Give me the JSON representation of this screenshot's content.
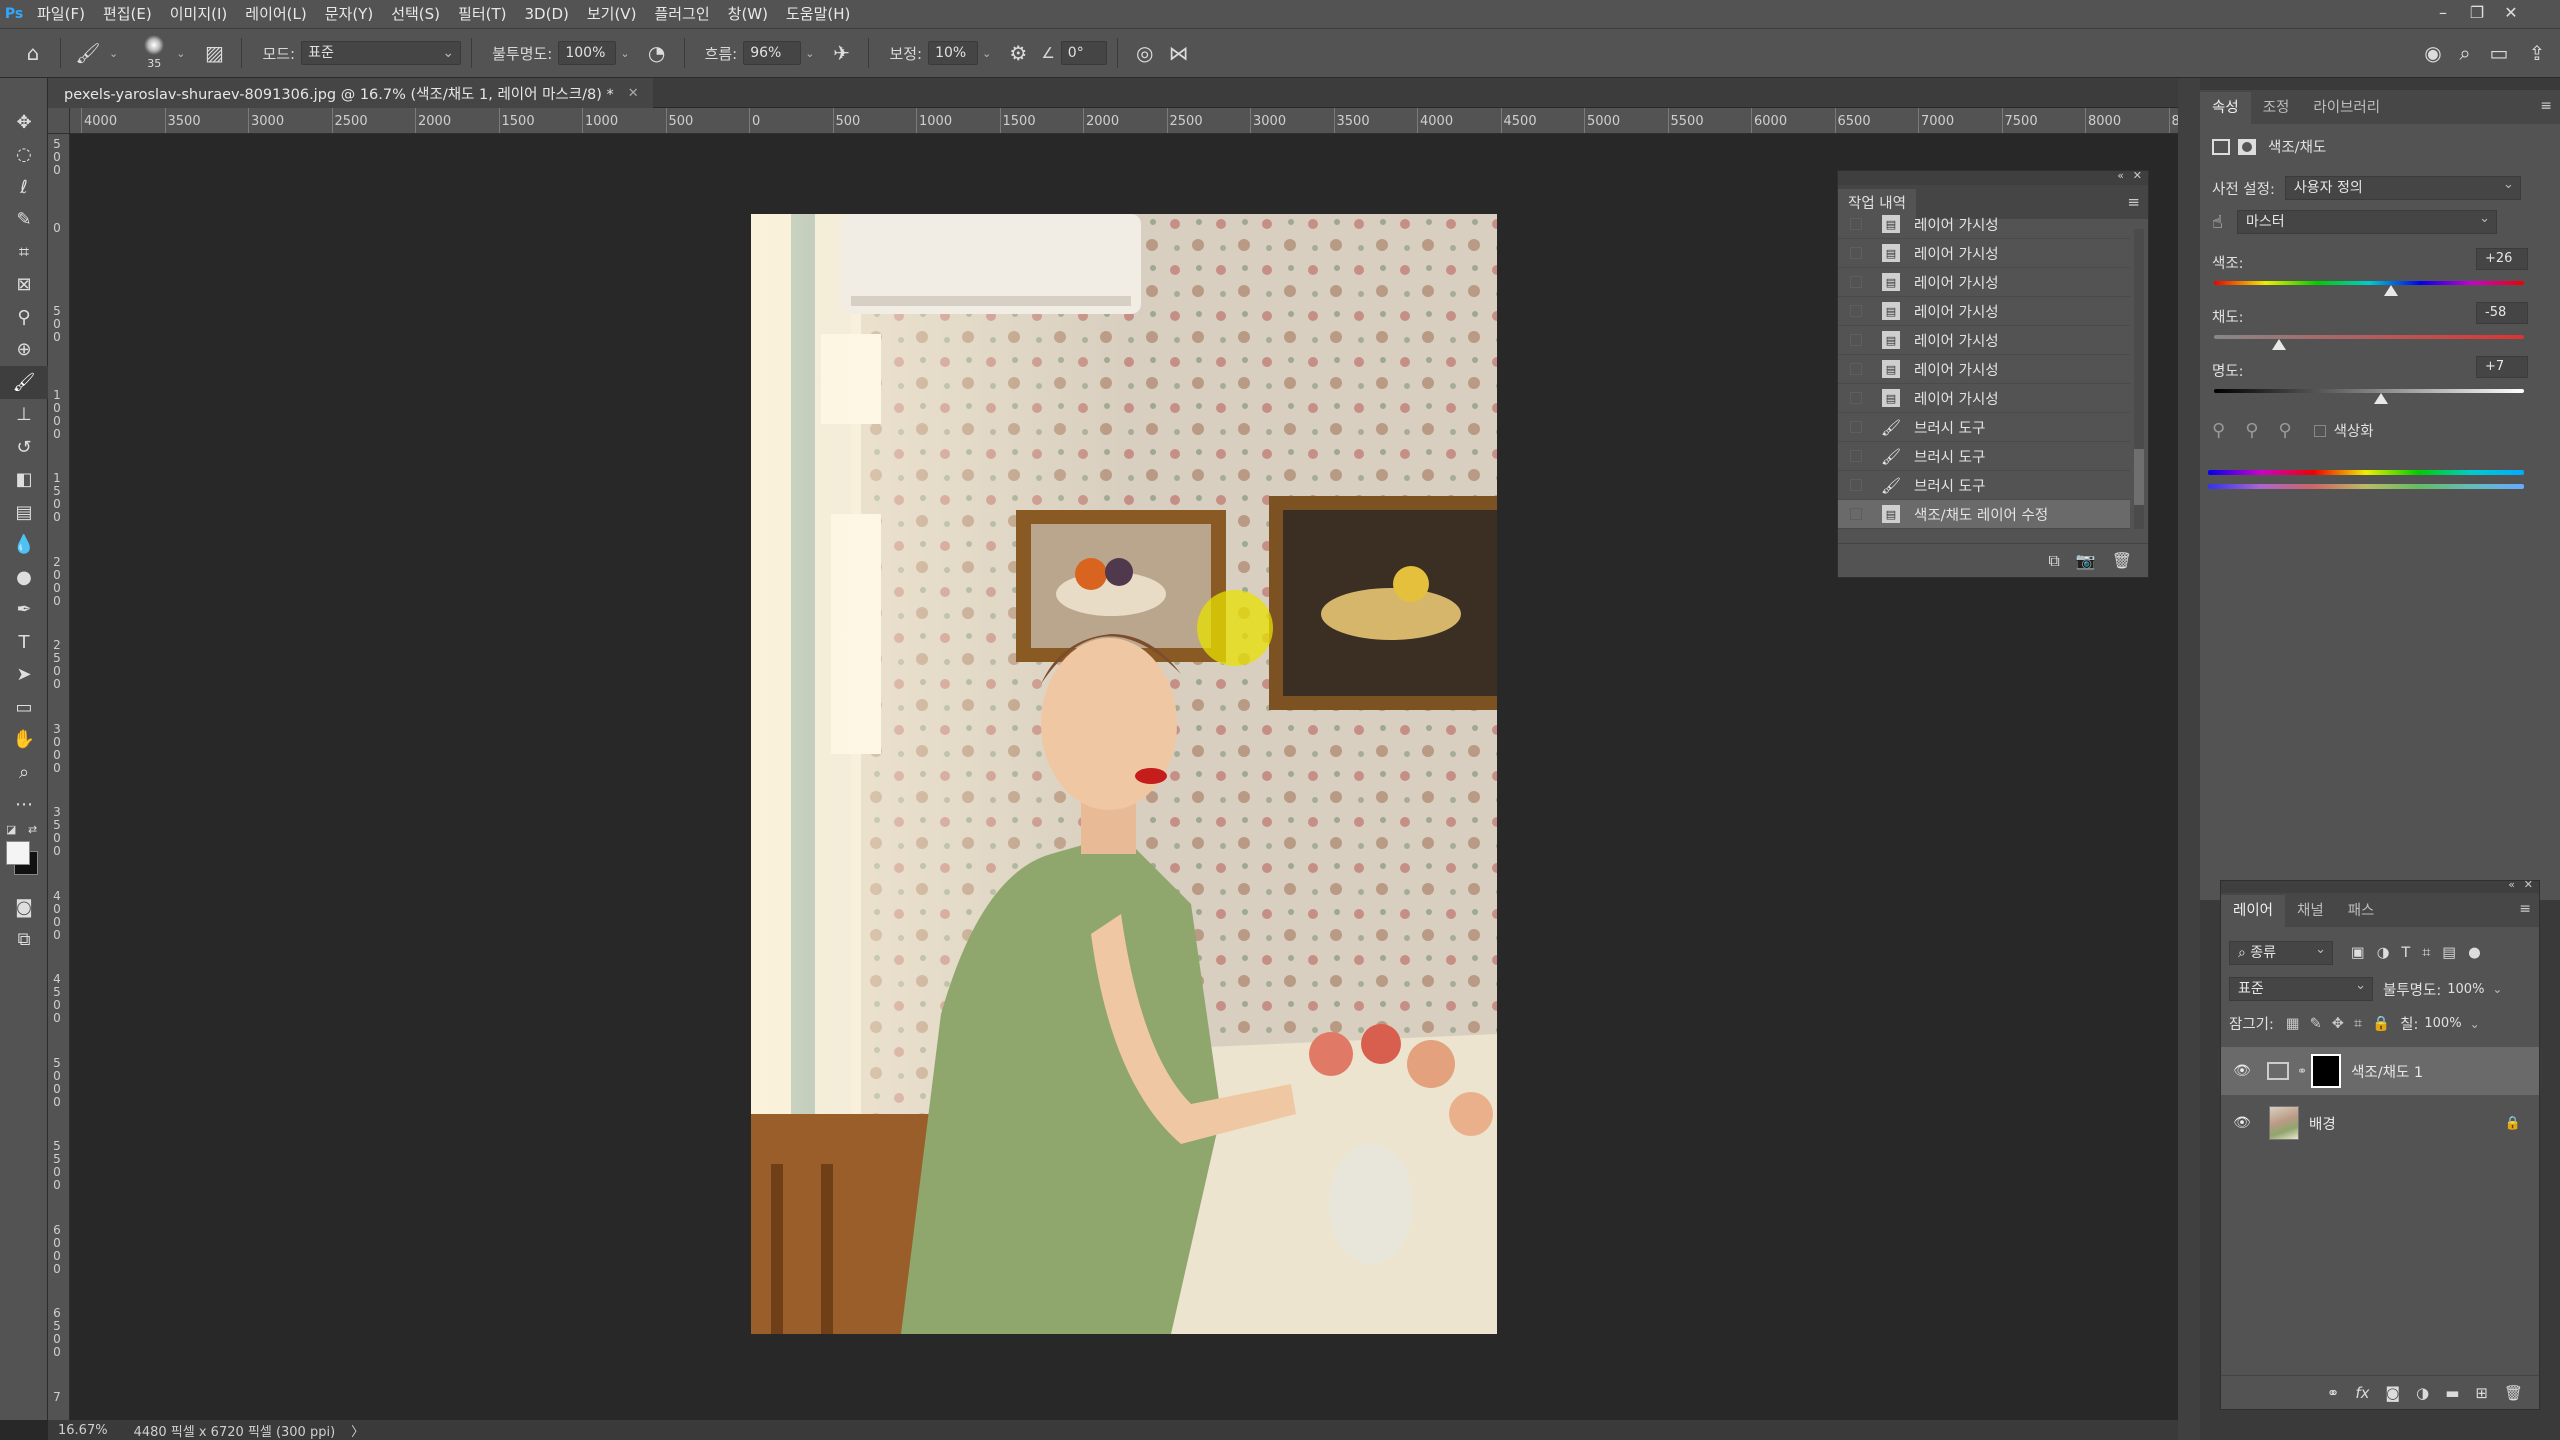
{
  "menubar": {
    "logo": "Ps",
    "items": [
      "파일(F)",
      "편집(E)",
      "이미지(I)",
      "레이어(L)",
      "문자(Y)",
      "선택(S)",
      "필터(T)",
      "3D(D)",
      "보기(V)",
      "플러그인",
      "창(W)",
      "도움말(H)"
    ]
  },
  "options": {
    "brush_size": "35",
    "mode_label": "모드:",
    "mode_value": "표준",
    "opacity_label": "불투명도:",
    "opacity_value": "100%",
    "flow_label": "흐름:",
    "flow_value": "96%",
    "smoothing_label": "보정:",
    "smoothing_value": "10%",
    "angle_value": "0°"
  },
  "document": {
    "tab_title": "pexels-yaroslav-shuraev-8091306.jpg @ 16.7% (색조/채도 1, 레이어 마스크/8) *",
    "zoom": "16.67%",
    "size_info": "4480 픽셀 x 6720 픽셀 (300 ppi)",
    "status_arrow": "〉"
  },
  "rulers": {
    "h_ticks": [
      "4000",
      "3500",
      "3000",
      "2500",
      "2000",
      "1500",
      "1000",
      "500",
      "0",
      "500",
      "1000",
      "1500",
      "2000",
      "2500",
      "3000",
      "3500",
      "4000",
      "4500",
      "5000",
      "5500",
      "6000",
      "6500",
      "7000",
      "7500",
      "8000",
      "8"
    ],
    "v_ticks": [
      "500",
      "0",
      "500",
      "1000",
      "1500",
      "2000",
      "2500",
      "3000",
      "3500",
      "4000",
      "4500",
      "5000",
      "5500",
      "6000",
      "6500",
      "7"
    ]
  },
  "history": {
    "title": "작업 내역",
    "items": [
      {
        "label": "레이어 가시성",
        "icon": "layer"
      },
      {
        "label": "레이어 가시성",
        "icon": "layer"
      },
      {
        "label": "레이어 가시성",
        "icon": "layer"
      },
      {
        "label": "레이어 가시성",
        "icon": "layer"
      },
      {
        "label": "레이어 가시성",
        "icon": "layer"
      },
      {
        "label": "레이어 가시성",
        "icon": "layer"
      },
      {
        "label": "레이어 가시성",
        "icon": "layer"
      },
      {
        "label": "브러시 도구",
        "icon": "brush"
      },
      {
        "label": "브러시 도구",
        "icon": "brush"
      },
      {
        "label": "브러시 도구",
        "icon": "brush"
      },
      {
        "label": "색조/채도 레이어 수정",
        "icon": "layer"
      }
    ]
  },
  "properties": {
    "tabs": [
      "속성",
      "조정",
      "라이브러리"
    ],
    "header": "색조/채도",
    "preset_label": "사전 설정:",
    "preset_value": "사용자 정의",
    "channel_value": "마스터",
    "hue_label": "색조:",
    "hue_value": "+26",
    "hue_level": 0.57,
    "sat_label": "채도:",
    "sat_value": "-58",
    "sat_level": 0.21,
    "light_label": "명도:",
    "light_value": "+7",
    "light_level": 0.54,
    "colorize_label": "색상화"
  },
  "layers": {
    "tabs": [
      "레이어",
      "채널",
      "패스"
    ],
    "filter_label": "종류",
    "blend_mode": "표준",
    "opacity_label": "불투명도:",
    "opacity_value": "100%",
    "lock_label": "잠그기:",
    "fill_label": "칠:",
    "fill_value": "100%",
    "items": [
      {
        "name": "색조/채도 1",
        "selected": true
      },
      {
        "name": "배경",
        "selected": false
      }
    ]
  },
  "colors": {
    "accent": "#31a8ff",
    "panel": "#535353",
    "canvas": "#282828"
  }
}
